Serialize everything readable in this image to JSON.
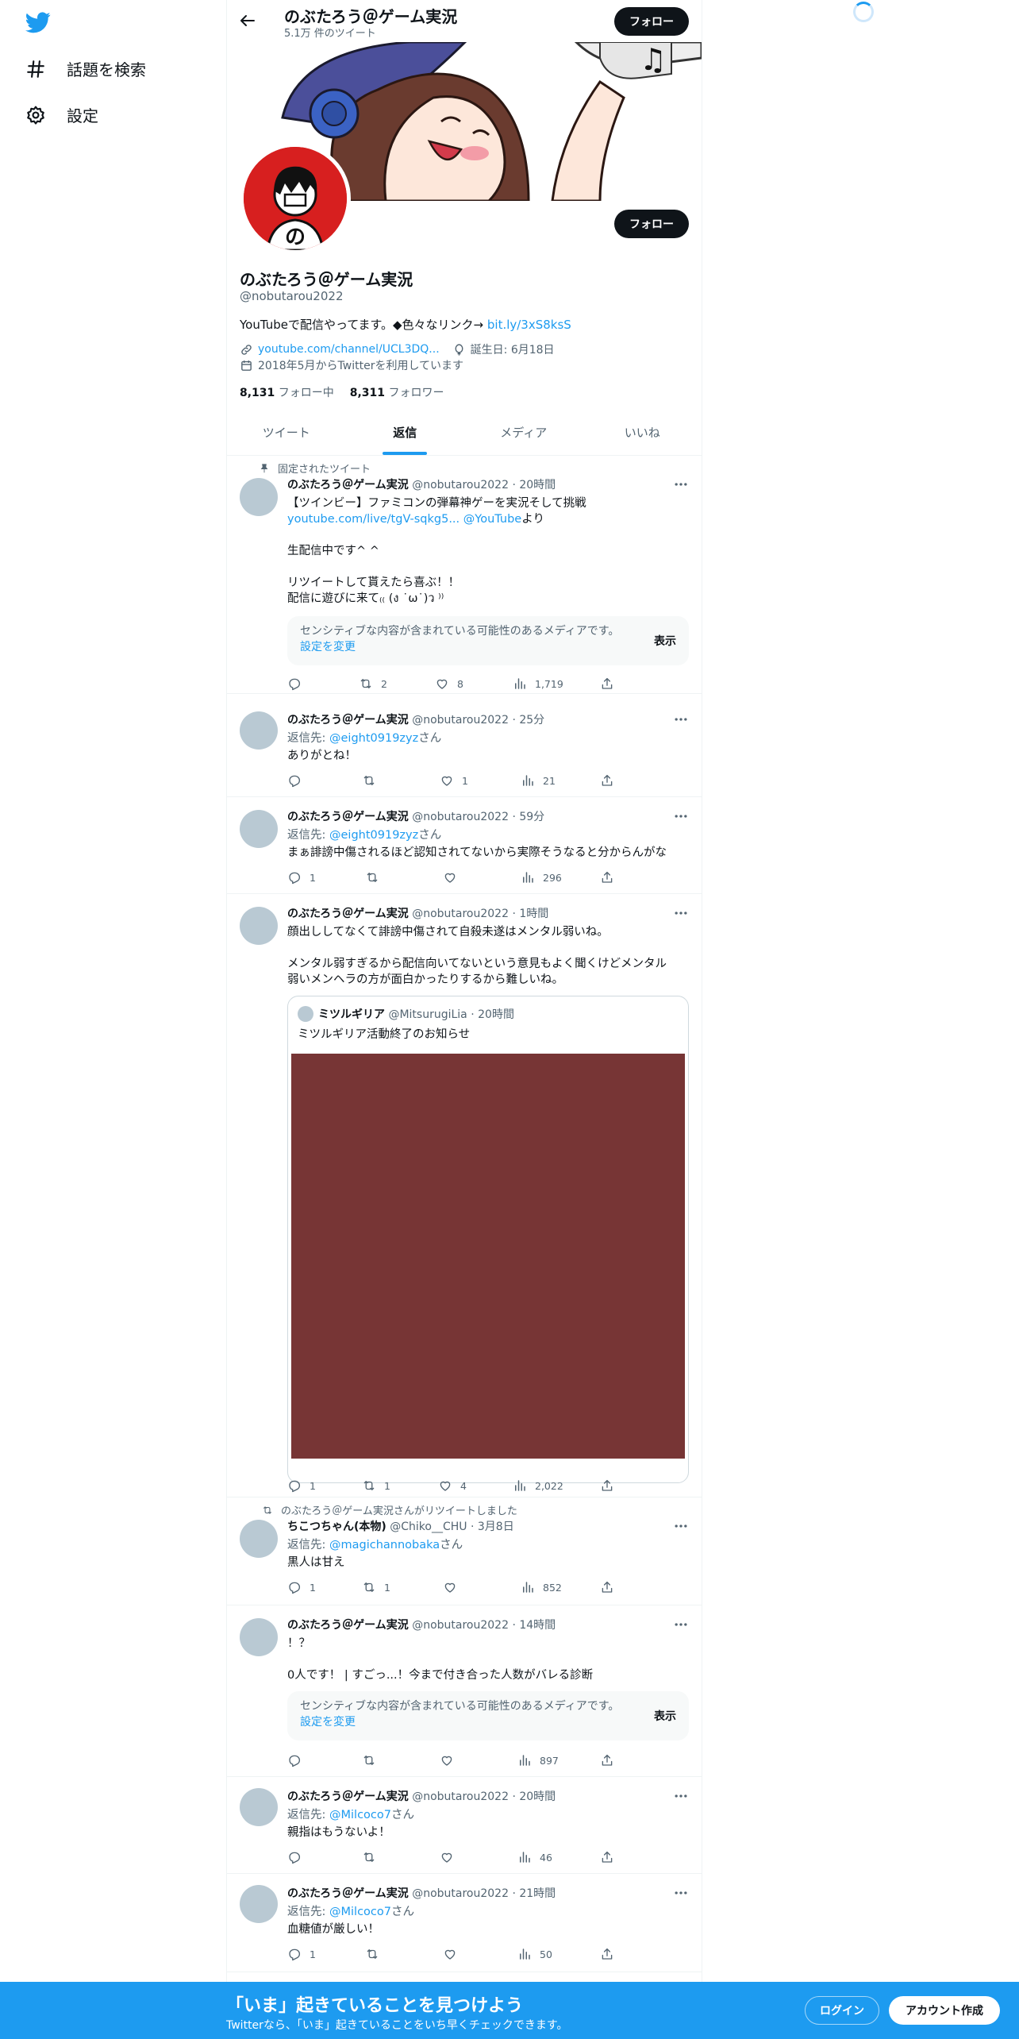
{
  "nav": {
    "explore_label": "話題を検索",
    "settings_label": "設定"
  },
  "header": {
    "name": "のぶたろう＠ゲーム実況",
    "tweet_count": "5.1万 件のツイート",
    "follow_label": "フォロー"
  },
  "profile": {
    "name": "のぶたろう＠ゲーム実況",
    "handle": "@nobutarou2022",
    "bio_text": "YouTubeで配信やってます。◆色々なリンク→ ",
    "bio_link": "bit.ly/3xS8ksS",
    "website": "youtube.com/channel/UCL3DQ...",
    "birthday": "誕生日: 6月18日",
    "joined": "2018年5月からTwitterを利用しています",
    "following_count": "8,131",
    "following_label": "フォロー中",
    "followers_count": "8,311",
    "followers_label": "フォロワー",
    "follow_label": "フォロー"
  },
  "tabs": [
    "ツイート",
    "返信",
    "メディア",
    "いいね"
  ],
  "active_tab": "返信",
  "sensitive": {
    "text": "センシティブな内容が含まれている可能性のあるメディアです。",
    "link": "設定を変更",
    "show": "表示"
  },
  "tweets": [
    {
      "social": "固定されたツイート",
      "name": "のぶたろう＠ゲーム実況",
      "handle": "@nobutarou2022",
      "time": "20時間",
      "line1": "【ツインビー】ファミコンの弾幕神ゲーを実況そして挑戦",
      "link1": "youtube.com/live/tgV-sqkg5...",
      "link2": "@YouTube",
      "line2_suffix": "より",
      "line3": "生配信中です^ ^",
      "line4": "リツイートして貰えたら喜ぶ！！",
      "line5": "配信に遊びに来て₍₍ (ง ˙ω˙)ว ⁾⁾",
      "retweets": "2",
      "likes": "8",
      "views": "1,719"
    },
    {
      "name": "のぶたろう＠ゲーム実況",
      "handle": "@nobutarou2022",
      "time": "25分",
      "reply_prefix": "返信先: ",
      "reply_to": "@eight0919zyz",
      "reply_suffix": "さん",
      "text": "ありがとね！",
      "likes": "1",
      "views": "21"
    },
    {
      "name": "のぶたろう＠ゲーム実況",
      "handle": "@nobutarou2022",
      "time": "59分",
      "reply_prefix": "返信先: ",
      "reply_to": "@eight0919zyz",
      "reply_suffix": "さん",
      "text": "まぁ誹謗中傷されるほど認知されてないから実際そうなると分からんがな",
      "replies": "1",
      "views": "296"
    },
    {
      "name": "のぶたろう＠ゲーム実況",
      "handle": "@nobutarou2022",
      "time": "1時間",
      "line1": "顔出ししてなくて誹謗中傷されて自殺未遂はメンタル弱いね。",
      "line2": "メンタル弱すぎるから配信向いてないという意見もよく聞くけどメンタル",
      "line3": "弱いメンヘラの方が面白かったりするから難しいね。",
      "quote_name": "ミツルギリア",
      "quote_handle": "@MitsurugiLia",
      "quote_time": "20時間",
      "quote_text": "ミツルギリア活動終了のお知らせ",
      "replies": "1",
      "retweets": "1",
      "likes": "4",
      "views": "2,022"
    },
    {
      "social": "のぶたろう＠ゲーム実況さんがリツイートしました",
      "name": "ちこつちゃん(本物)",
      "handle": "@Chiko__CHU",
      "time": "3月8日",
      "reply_prefix": "返信先: ",
      "reply_to": "@magichannobaka",
      "reply_suffix": "さん",
      "text": "黒人は甘え",
      "replies": "1",
      "retweets": "1",
      "views": "852"
    },
    {
      "name": "のぶたろう＠ゲーム実況",
      "handle": "@nobutarou2022",
      "time": "14時間",
      "line1": "！？",
      "line2": "0人です！ | すごっ...！今まで付き合った人数がバレる診断",
      "views": "897"
    },
    {
      "name": "のぶたろう＠ゲーム実況",
      "handle": "@nobutarou2022",
      "time": "20時間",
      "reply_prefix": "返信先: ",
      "reply_to": "@Milcoco7",
      "reply_suffix": "さん",
      "text": "親指はもうないよ！",
      "views": "46"
    },
    {
      "name": "のぶたろう＠ゲーム実況",
      "handle": "@nobutarou2022",
      "time": "21時間",
      "reply_prefix": "返信先: ",
      "reply_to": "@Milcoco7",
      "reply_suffix": "さん",
      "text": "血糖値が厳しい！",
      "replies": "1",
      "views": "50"
    }
  ],
  "bottom": {
    "title": "「いま」起きていることを見つけよう",
    "subtitle": "Twitterなら、「いま」起きていることをいち早くチェックできます。",
    "login": "ログイン",
    "signup": "アカウント作成"
  },
  "colors": {
    "accent": "#1d9bf0",
    "text": "#0f1419",
    "secondary": "#536471",
    "sensitive_bg": "#f7f9f9",
    "quote_media": "#773535"
  }
}
